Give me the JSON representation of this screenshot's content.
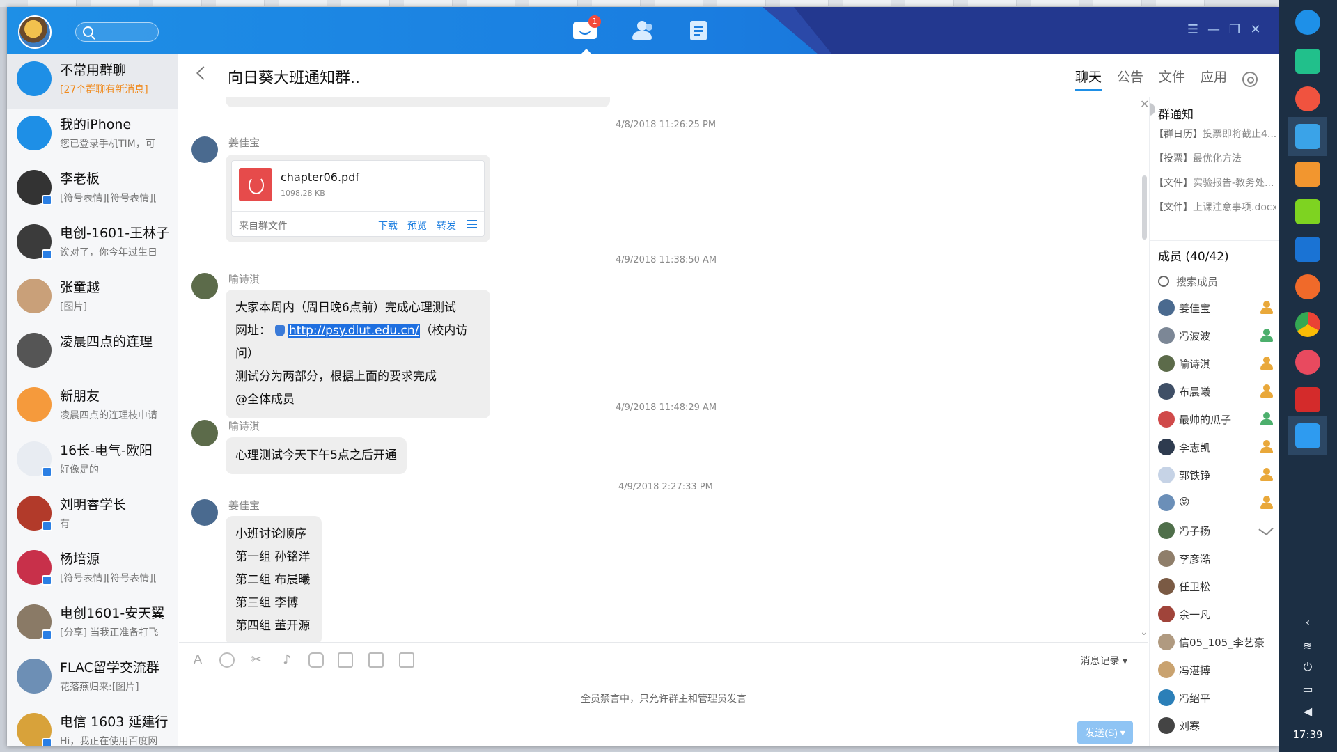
{
  "topbar": {
    "search_placeholder": "",
    "nav": [
      {
        "name": "messages",
        "badge": "1"
      },
      {
        "name": "contacts"
      },
      {
        "name": "documents"
      }
    ],
    "window_controls": [
      "☰",
      "—",
      "❐",
      "✕"
    ]
  },
  "conversations": [
    {
      "name": "不常用群聊",
      "preview": "[27个群聊有新消息]",
      "alert": true,
      "active": true,
      "avatar_color": "#1e8fe6"
    },
    {
      "name": "我的iPhone",
      "preview": "您已登录手机TIM，可",
      "avatar_color": "#1e8fe6"
    },
    {
      "name": "李老板",
      "preview": "[符号表情][符号表情][",
      "avatar_color": "#333333"
    },
    {
      "name": "电创-1601-王林子",
      "preview": "诶对了，你今年过生日",
      "avatar_color": "#3b3b3b"
    },
    {
      "name": "张童越",
      "preview": "[图片]",
      "avatar_color": "#c9a079"
    },
    {
      "name": "凌晨四点的连理",
      "preview": "",
      "avatar_color": "#555555"
    },
    {
      "name": "新朋友",
      "preview": "凌晨四点的连理枝申请",
      "avatar_color": "#f59a3c"
    },
    {
      "name": "16长-电气-欧阳",
      "preview": "好像是的",
      "avatar_color": "#2d5d9c"
    },
    {
      "name": "刘明睿学长",
      "preview": "有",
      "avatar_color": "#b23a2a"
    },
    {
      "name": "杨培源",
      "preview": "[符号表情][符号表情][",
      "avatar_color": "#c8304a"
    },
    {
      "name": "电创1601-安天翼",
      "preview": "[分享] 当我正准备打飞",
      "avatar_color": "#8a7a66"
    },
    {
      "name": "FLAC留学交流群",
      "preview": "花落燕归来:[图片]",
      "avatar_color": "#6d8fb5"
    },
    {
      "name": "电信 1603 延建行",
      "preview": "Hi，我正在使用百度网",
      "avatar_color": "#d8a23a"
    }
  ],
  "chat": {
    "title": "向日葵大班通知群..",
    "tabs": [
      "聊天",
      "公告",
      "文件",
      "应用"
    ],
    "messages": {
      "ts1": "4/8/2018 11:26:25 PM",
      "m1_sender": "姜佳宝",
      "file_name": "chapter06.pdf",
      "file_size": "1098.28 KB",
      "file_source": "来自群文件",
      "file_actions": [
        "下载",
        "预览",
        "转发"
      ],
      "ts2": "4/9/2018 11:38:50 AM",
      "m2_sender": "喻诗淇",
      "m2_line1": "大家本周内（周日晚6点前）完成心理测试",
      "m2_label": "网址：",
      "m2_link": "http://psy.dlut.edu.cn/",
      "m2_suffix": "（校内访问）",
      "m2_line3": "测试分为两部分，根据上面的要求完成",
      "m2_line4": "@全体成员",
      "ts3": "4/9/2018 11:48:29 AM",
      "m3_sender": "喻诗淇",
      "m3_text": "心理测试今天下午5点之后开通",
      "ts4": "4/9/2018 2:27:33 PM",
      "m4_sender": "姜佳宝",
      "m4_lines": [
        "小班讨论顺序",
        "第一组  孙铭洋",
        "第二组  布晨曦",
        "第三组  李博",
        "第四组  董开源"
      ]
    }
  },
  "input": {
    "history_label": "消息记录",
    "muted_note": "全员禁言中，只允许群主和管理员发言",
    "send_label": "发送(S)"
  },
  "right_panel": {
    "notice_title": "群通知",
    "notices": [
      {
        "tag": "【群日历】",
        "text": "投票即将截止4..."
      },
      {
        "tag": "【投票】",
        "text": "最优化方法"
      },
      {
        "tag": "【文件】",
        "text": "实验报告-教务处..."
      },
      {
        "tag": "【文件】",
        "text": "上课注意事项.docx"
      }
    ],
    "members_title": "成员 (40/42)",
    "member_search": "搜索成员",
    "members": [
      {
        "name": "姜佳宝",
        "role": "owner"
      },
      {
        "name": "冯波波",
        "role": "admin"
      },
      {
        "name": "喻诗淇",
        "role": "owner"
      },
      {
        "name": "布晨曦",
        "role": "owner"
      },
      {
        "name": "最帅的瓜子",
        "role": "admin"
      },
      {
        "name": "李志凯",
        "role": "owner"
      },
      {
        "name": "郭铁铮",
        "role": "owner"
      },
      {
        "name": "😝",
        "role": "owner"
      },
      {
        "name": "冯子扬",
        "role": "edit"
      },
      {
        "name": "李彦澔",
        "role": ""
      },
      {
        "name": "任卫松",
        "role": ""
      },
      {
        "name": "余一凡",
        "role": ""
      },
      {
        "name": "信05_105_李艺豪",
        "role": ""
      },
      {
        "name": "冯湛搏",
        "role": ""
      },
      {
        "name": "冯绍平",
        "role": ""
      },
      {
        "name": "刘寒",
        "role": ""
      }
    ]
  },
  "dock": {
    "clock": "17:39"
  }
}
